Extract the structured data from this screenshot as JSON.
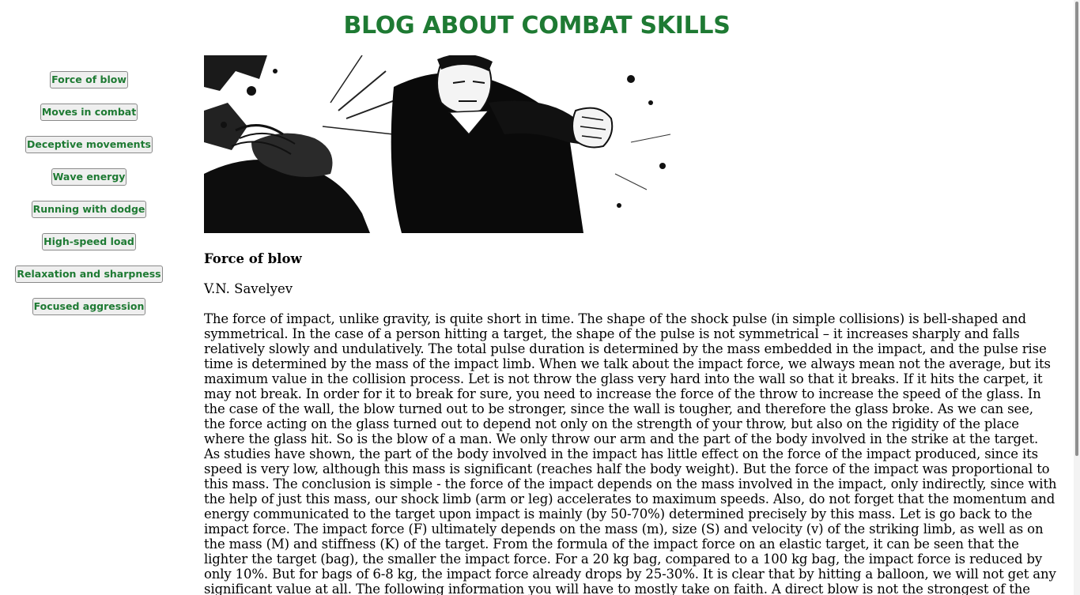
{
  "site": {
    "title": "BLOG ABOUT COMBAT SKILLS"
  },
  "sidebar": {
    "items": [
      {
        "label": "Force of blow"
      },
      {
        "label": "Moves in combat"
      },
      {
        "label": "Deceptive movements"
      },
      {
        "label": "Wave energy"
      },
      {
        "label": "Running with dodge"
      },
      {
        "label": "High-speed load"
      },
      {
        "label": "Relaxation and sharpness"
      },
      {
        "label": "Focused aggression"
      }
    ]
  },
  "hero_image": {
    "description_icon": "comic-fight-illustration"
  },
  "article": {
    "title": "Force of blow",
    "author": "V.N. Savelyev",
    "body": "The force of impact, unlike gravity, is quite short in time. The shape of the shock pulse (in simple collisions) is bell-shaped and symmetrical. In the case of a person hitting a target, the shape of the pulse is not symmetrical – it increases sharply and falls relatively slowly and undulatively. The total pulse duration is determined by the mass embedded in the impact, and the pulse rise time is determined by the mass of the impact limb. When we talk about the impact force, we always mean not the average, but its maximum value in the collision process. Let is not throw the glass very hard into the wall so that it breaks. If it hits the carpet, it may not break. In order for it to break for sure, you need to increase the force of the throw to increase the speed of the glass. In the case of the wall, the blow turned out to be stronger, since the wall is tougher, and therefore the glass broke. As we can see, the force acting on the glass turned out to depend not only on the strength of your throw, but also on the rigidity of the place where the glass hit. So is the blow of a man. We only throw our arm and the part of the body involved in the strike at the target. As studies have shown, the part of the body involved in the impact has little effect on the force of the impact produced, since its speed is very low, although this mass is significant (reaches half the body weight). But the force of the impact was proportional to this mass. The conclusion is simple - the force of the impact depends on the mass involved in the impact, only indirectly, since with the help of just this mass, our shock limb (arm or leg) accelerates to maximum speeds. Also, do not forget that the momentum and energy communicated to the target upon impact is mainly (by 50-70%) determined precisely by this mass. Let is go back to the impact force. The impact force (F) ultimately depends on the mass (m), size (S) and velocity (v) of the striking limb, as well as on the mass (M) and stiffness (K) of the target. From the formula of the impact force on an elastic target, it can be seen that the lighter the target (bag), the smaller the impact force. For a 20 kg bag, compared to a 100 kg bag, the impact force is reduced by only 10%. But for bags of 6-8 kg, the impact force already drops by 25-30%. It is clear that by hitting a balloon, we will not get any significant value at all. The following information you will have to mostly take on faith. A direct blow is not the strongest of the"
  },
  "colors": {
    "accent": "#1e7a33",
    "button_bg": "#efefef",
    "button_border": "#8a8a8a"
  }
}
